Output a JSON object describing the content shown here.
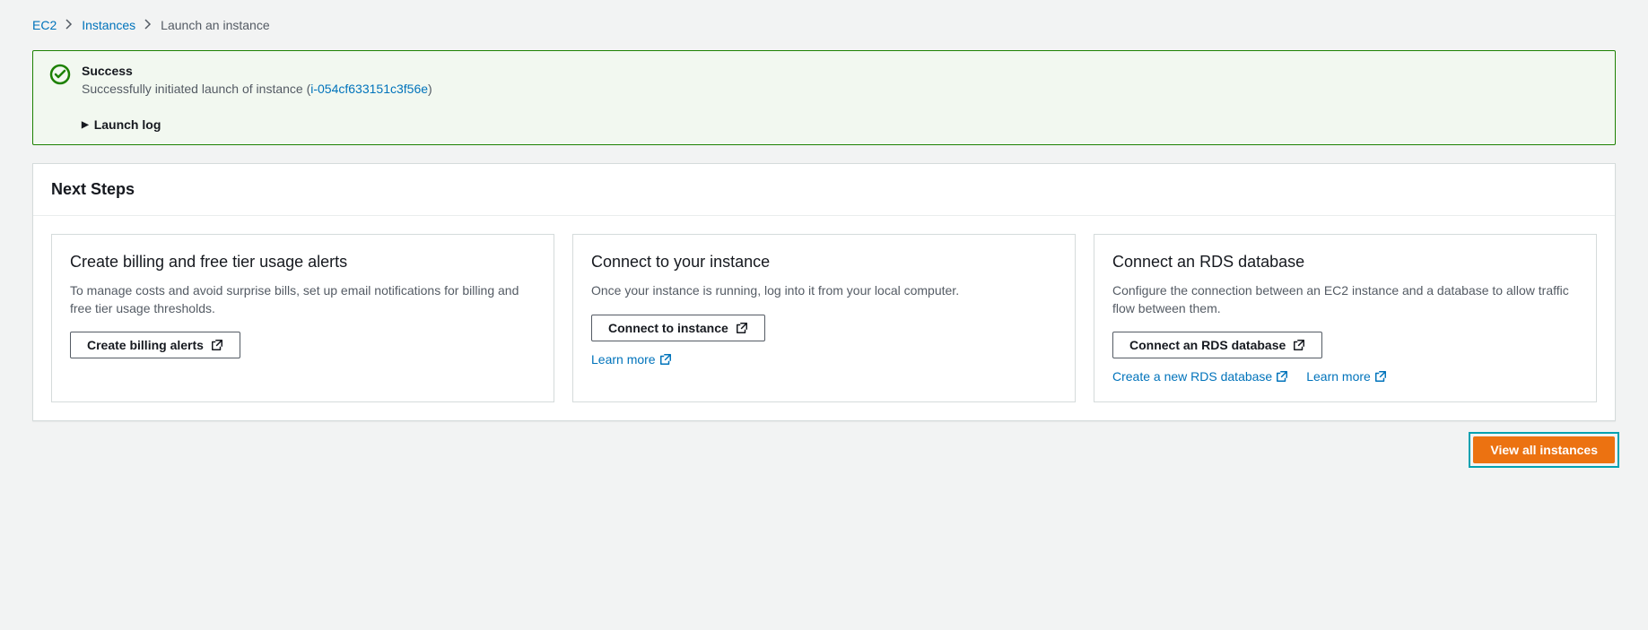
{
  "breadcrumb": {
    "items": [
      "EC2",
      "Instances"
    ],
    "current": "Launch an instance"
  },
  "alert": {
    "title": "Success",
    "message_prefix": "Successfully initiated launch of instance (",
    "instance_id": "i-054cf633151c3f56e",
    "message_suffix": ")",
    "launch_log_label": "Launch log"
  },
  "panel": {
    "title": "Next Steps"
  },
  "cards": [
    {
      "title": "Create billing and free tier usage alerts",
      "desc": "To manage costs and avoid surprise bills, set up email notifications for billing and free tier usage thresholds.",
      "button": "Create billing alerts",
      "links": []
    },
    {
      "title": "Connect to your instance",
      "desc": "Once your instance is running, log into it from your local computer.",
      "button": "Connect to instance",
      "links": [
        {
          "label": "Learn more"
        }
      ]
    },
    {
      "title": "Connect an RDS database",
      "desc": "Configure the connection between an EC2 instance and a database to allow traffic flow between them.",
      "button": "Connect an RDS database",
      "links": [
        {
          "label": "Create a new RDS database"
        },
        {
          "label": "Learn more"
        }
      ]
    }
  ],
  "footer": {
    "view_all": "View all instances"
  }
}
